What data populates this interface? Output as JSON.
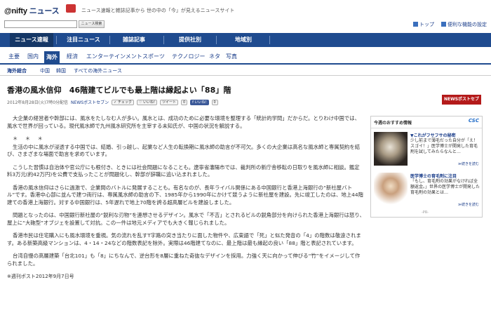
{
  "header": {
    "logo_text": "@nifty",
    "logo_news": "ニュース",
    "tagline": "ニュース速報と雑誌記事から 世の中の「今」が見えるニュースサイト",
    "search_button": "ニュース検索",
    "top_links": [
      "トップ",
      "便利な機能の設定"
    ]
  },
  "main_nav": {
    "tabs": [
      {
        "label": "ニュース速報",
        "active": true
      },
      {
        "label": "注目ニュース",
        "active": false
      },
      {
        "label": "雑誌記事",
        "active": false
      },
      {
        "label": "提供社別",
        "active": false
      },
      {
        "label": "地域別",
        "active": false
      }
    ]
  },
  "sub_nav": {
    "items": [
      {
        "label": "主要",
        "active": false
      },
      {
        "label": "国内",
        "active": false
      },
      {
        "label": "海外",
        "active": true
      },
      {
        "label": "経済",
        "active": false
      },
      {
        "label": "エンターテインメント",
        "active": false
      },
      {
        "label": "スポーツ",
        "active": false
      },
      {
        "label": "テクノロジー",
        "active": false
      },
      {
        "label": "ネタ",
        "active": false
      },
      {
        "label": "写真",
        "active": false
      }
    ]
  },
  "third_nav": {
    "items": [
      "海外総合",
      "中国",
      "韓国",
      "すべての海外ニュース"
    ]
  },
  "article": {
    "headline": "香港の風水信仰　46階建てビルでも最上階は縁起よい「88」階",
    "date": "2012年8月28日(火)7時0分配信",
    "source": "NEWSポストセブン",
    "buttons": {
      "check": "チェック",
      "iine": "いいね!",
      "tweet": "ツイート",
      "tweet_count": "0",
      "fb_like": "いいね!",
      "fb_count": "0"
    },
    "badge": "NEWSポストセブン",
    "paragraphs": [
      "大企業の経営者や幹部には、風水をたしなむ人が多い。風水とは、成功のために必要な環境を整理する「統計的学問」だからだ。とりわけ中国では、風水で世界が回っている。現代風水師で九州風水研究所を主宰する未知氏が、中国の状況を解説する。",
      "＊ ＊ ＊",
      "生活の中に風水が浸透する中国では、結婚、引っ越し、起業など人生の転換期に風水師の助言が不可欠。多くの大企業は高名な風水師と専属契約を結び、さまざまな場面で助言を求めています。",
      "こうした習慣は自治体や官公庁にも根付き、ときには社会問題になることも。遼寧省瀋陽市では、裁判所の新庁舎移転の日取りを風水師に相談。鑑定料3万元(約42万円)を公費で支払ったことが問題化し、幹部が辞職に追い込まれました。",
      "香港の風水信仰はさらに過激で、企業間のバトルに発展することも。有名なのが、長年ライバル関係にある中国銀行と香港上海銀行の“新社屋バトル”です。香港中心部に並んで建つ両行は、専属風水師の助言の下、1985年から1990年にかけて競うように新社屋を建設。先に竣工したのは、地上44階建ての香港上海銀行。対する中国銀行は、5年遅れで地上70階を誇る超高層ビルを建設しました。",
      "問題となったのは、中国銀行新社屋の“鋭利な刃物”を連想させるデザイン。風水で「不吉」とされるビルの鋭角部分を向けられた香港上海銀行は怒り、屋上に“大砲型”オブジェを設置して対抗。この一件は地元メディアでも大きく報じられました。",
      "香港市民は住宅購入にも風水環境を重視。気の流れを乱すT字路の突き当たりに面した物件や、広東語で「死」と似た発音の「4」の階数は敬遠されます。ある新築高級マンションは、4・14・24などの階数表記を除外。実際は46階建てなのに、最上階は最も縁起の良い「88」階と表記されています。",
      "台湾自慢の高層建築「台北101」も「8」にちなんで、逆台形を8層に重ねた奇抜なデザインを採用。力強く天に向かって伸びる“竹”をイメージして作られました。"
    ],
    "footnote": "※週刊ポスト2012年9月7日号"
  },
  "sidebox": {
    "title": "今週のおすすめ情報",
    "brand": "CSC",
    "item1_title": "▼これがフサフサの秘密",
    "item1_desc": "少し前まで薄毛だった自分が「え！スゴイ！」医学博士が開発した育毛剤を試してみたらなんと…",
    "item1_more": "≫続きを読む",
    "item2_title": "医学博士の育毛剤に注目",
    "item2_desc": "「もし、育毛剤の効果がなければ全額返金。」世界の医学博士が開発した育毛剤の効果とは…",
    "item2_more": "≫続きを読む",
    "pr": "-PR-"
  }
}
